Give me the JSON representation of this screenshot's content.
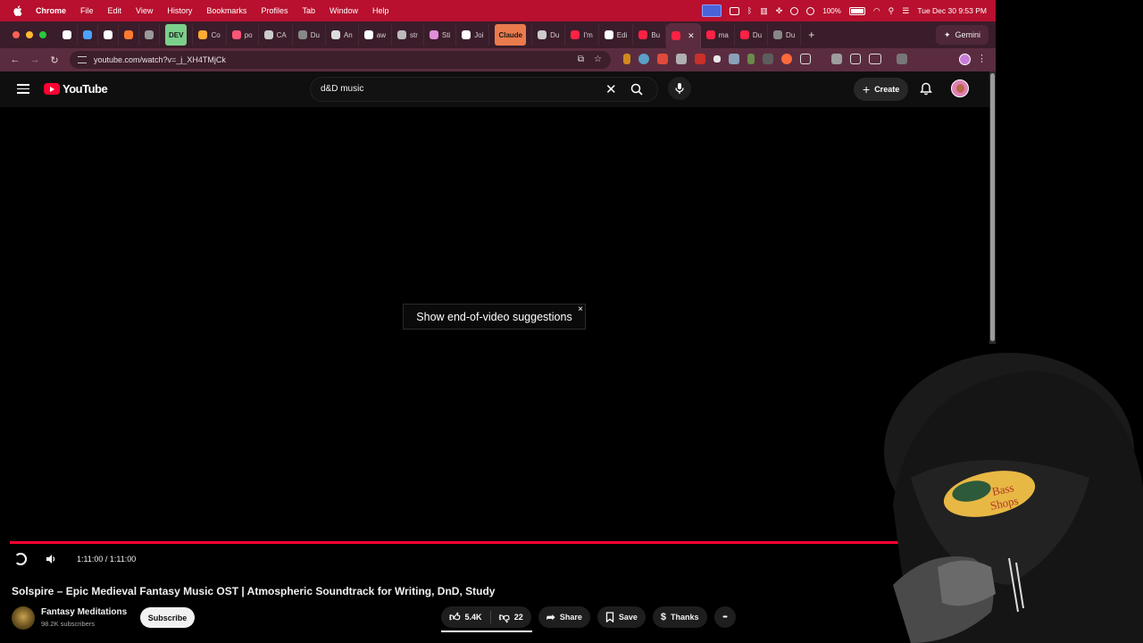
{
  "menubar": {
    "app": "Chrome",
    "items": [
      "File",
      "Edit",
      "View",
      "History",
      "Bookmarks",
      "Profiles",
      "Tab",
      "Window",
      "Help"
    ],
    "battery": "100%",
    "clock": "Tue Dec 30  9:53 PM"
  },
  "tabs": [
    {
      "label": "",
      "color": "#ffffff",
      "icon": "gmail-icon"
    },
    {
      "label": "",
      "color": "#4aa3ff",
      "icon": "docs-icon"
    },
    {
      "label": "",
      "color": "#ffffff",
      "icon": "github-icon"
    },
    {
      "label": "",
      "color": "#ff7a30",
      "icon": "firefox-icon"
    },
    {
      "label": "",
      "color": "#999999",
      "icon": "openai-icon"
    },
    {
      "label": "DEV",
      "color": "#7ad08b",
      "icon": "dev-icon",
      "pill": true
    },
    {
      "label": "Co",
      "color": "#ffaa33",
      "icon": "tab-icon"
    },
    {
      "label": "po",
      "color": "#ff5577",
      "icon": "tab-icon"
    },
    {
      "label": "CA",
      "color": "#cccccc",
      "icon": "tab-icon"
    },
    {
      "label": "Du",
      "color": "#888888",
      "icon": "tab-icon"
    },
    {
      "label": "An",
      "color": "#dddddd",
      "icon": "tab-icon"
    },
    {
      "label": "aw",
      "color": "#ffffff",
      "icon": "github-icon"
    },
    {
      "label": "str",
      "color": "#bbbbbb",
      "icon": "tab-icon"
    },
    {
      "label": "Sti",
      "color": "#e08dd8",
      "icon": "tab-icon"
    },
    {
      "label": "Joi",
      "color": "#ffffff",
      "icon": "tab-icon"
    },
    {
      "label": "Claude",
      "color": "#ea7b4d",
      "icon": "claude-icon",
      "pill": true
    },
    {
      "label": "Du",
      "color": "#cccccc",
      "icon": "tab-icon"
    },
    {
      "label": "I'm",
      "color": "#ff2244",
      "icon": "youtube-icon"
    },
    {
      "label": "Edi",
      "color": "#ffffff",
      "icon": "medium-icon"
    },
    {
      "label": "Bu",
      "color": "#ff2244",
      "icon": "youtube-icon"
    },
    {
      "label": "",
      "color": "#ff2244",
      "icon": "youtube-icon",
      "active": true
    },
    {
      "label": "ma",
      "color": "#ff2244",
      "icon": "youtube-icon"
    },
    {
      "label": "Du",
      "color": "#ff2244",
      "icon": "youtube-icon"
    },
    {
      "label": "Du",
      "color": "#888888",
      "icon": "tab-icon"
    }
  ],
  "gemini_label": "Gemini",
  "url": "youtube.com/watch?v=_j_XH4TMjCk",
  "youtube": {
    "logo_text": "YouTube",
    "search_query": "d&D music",
    "create_label": "Create"
  },
  "player": {
    "end_suggestions_label": "Show end-of-video suggestions",
    "close_glyph": "×",
    "time": "1:11:00 / 1:11:00",
    "progress": 1.0
  },
  "video": {
    "title": "Solspire – Epic Medieval Fantasy Music OST | Atmospheric Soundtrack for Writing, DnD, Study",
    "channel": "Fantasy Meditations",
    "subscribers": "98.2K subscribers",
    "subscribe_label": "Subscribe",
    "likes": "5.4K",
    "dislikes": "22",
    "share_label": "Share",
    "save_label": "Save",
    "thanks_label": "Thanks",
    "more_glyph": "•••"
  },
  "colors": {
    "menubar": "#b8102e",
    "youtube_red": "#ff0033",
    "tabstrip": "#3a1d2a"
  }
}
